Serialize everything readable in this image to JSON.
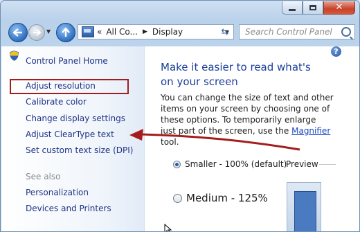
{
  "window": {
    "caption_buttons": [
      "minimize",
      "maximize",
      "close"
    ]
  },
  "navbar": {
    "back_icon": "back-arrow-icon",
    "forward_icon": "forward-arrow-icon",
    "up_icon": "up-arrow-icon",
    "address": {
      "overflow": "«",
      "crumb1": "All Co...",
      "crumb2": "Display"
    },
    "search_placeholder": "Search Control Panel"
  },
  "sidebar": {
    "home": "Control Panel Home",
    "items": [
      {
        "label": "Adjust resolution"
      },
      {
        "label": "Calibrate color",
        "icon": "shield-icon"
      },
      {
        "label": "Change display settings"
      },
      {
        "label": "Adjust ClearType text",
        "highlighted": true
      },
      {
        "label": "Set custom text size (DPI)"
      }
    ],
    "see_also": "See also",
    "see_also_items": [
      {
        "label": "Personalization"
      },
      {
        "label": "Devices and Printers"
      }
    ]
  },
  "content": {
    "help": "?",
    "heading": "Make it easier to read what's on your screen",
    "para_before": "You can change the size of text and other items on your screen by choosing one of these options. To temporarily enlarge just part of the screen, use the ",
    "para_link": "Magnifier",
    "para_after": " tool.",
    "options": [
      {
        "label": "Smaller - 100% (default)",
        "selected": true
      },
      {
        "label": "Medium - 125%",
        "selected": false
      }
    ],
    "preview_label": "Preview"
  },
  "colors": {
    "link": "#1e3287",
    "heading": "#1c3f9a",
    "annotation": "#a51c1c"
  }
}
